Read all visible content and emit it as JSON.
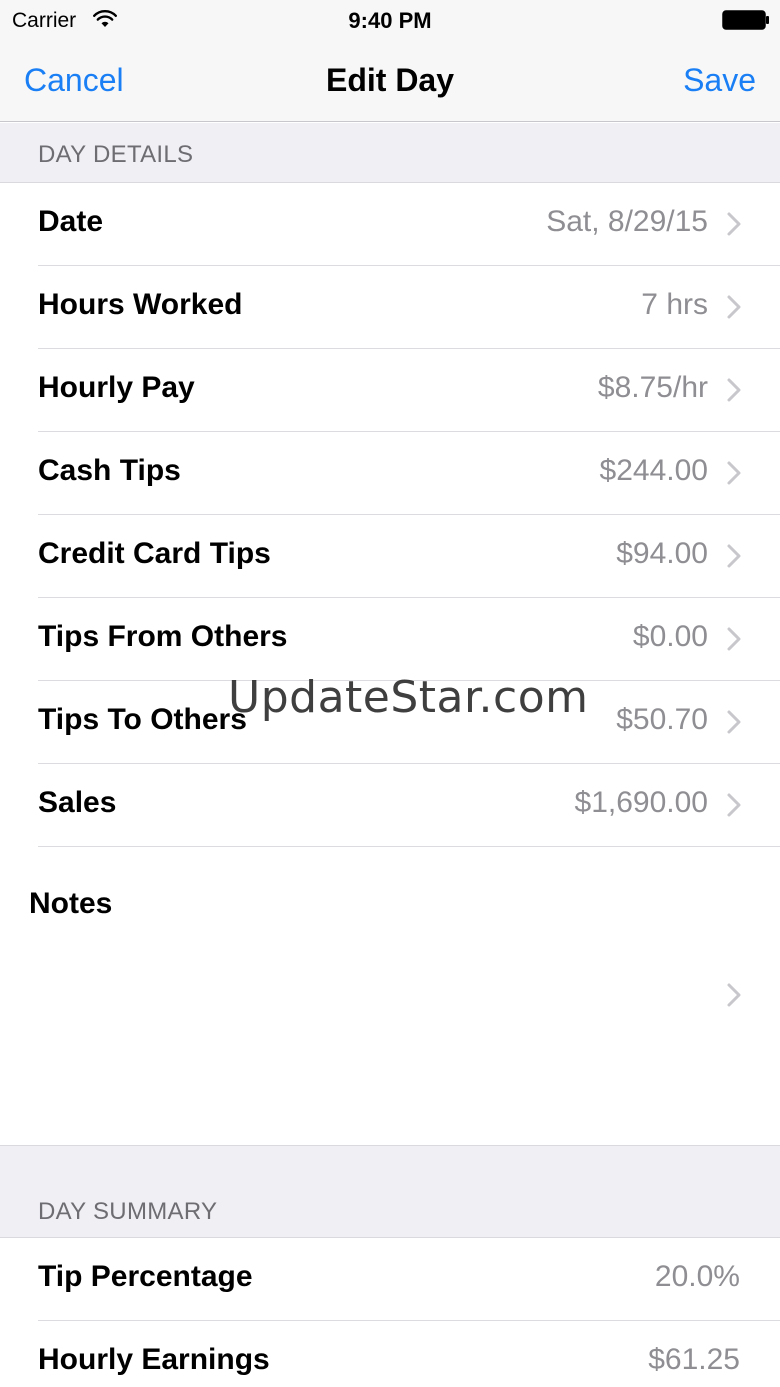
{
  "status_bar": {
    "carrier": "Carrier",
    "time": "9:40 PM",
    "wifi_icon": "wifi-icon",
    "battery_icon": "battery-icon"
  },
  "nav": {
    "cancel_label": "Cancel",
    "title": "Edit Day",
    "save_label": "Save"
  },
  "day_details": {
    "header": "DAY DETAILS",
    "rows": [
      {
        "label": "Date",
        "value": "Sat, 8/29/15"
      },
      {
        "label": "Hours Worked",
        "value": "7 hrs"
      },
      {
        "label": "Hourly Pay",
        "value": "$8.75/hr"
      },
      {
        "label": "Cash Tips",
        "value": "$244.00"
      },
      {
        "label": "Credit Card Tips",
        "value": "$94.00"
      },
      {
        "label": "Tips From Others",
        "value": "$0.00"
      },
      {
        "label": "Tips To Others",
        "value": "$50.70"
      },
      {
        "label": "Sales",
        "value": "$1,690.00"
      }
    ],
    "notes_label": "Notes"
  },
  "day_summary": {
    "header": "DAY SUMMARY",
    "rows": [
      {
        "label": "Tip Percentage",
        "value": "20.0%"
      },
      {
        "label": "Hourly Earnings",
        "value": "$61.25"
      }
    ]
  },
  "watermark": "UpdateStar.com",
  "colors": {
    "accent": "#1a7ff5",
    "secondary_text": "#8e8e93",
    "group_background": "#efeff4"
  }
}
